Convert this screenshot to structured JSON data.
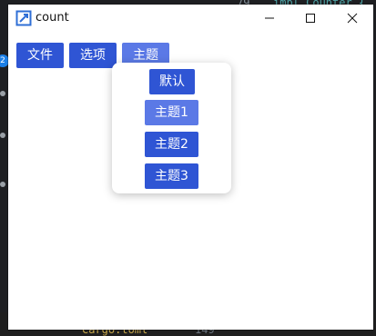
{
  "window": {
    "title": "count"
  },
  "menubar": {
    "items": [
      {
        "label": "文件"
      },
      {
        "label": "选项"
      },
      {
        "label": "主题"
      }
    ]
  },
  "theme_menu": {
    "items": [
      {
        "label": "默认"
      },
      {
        "label": "主题1"
      },
      {
        "label": "主题2"
      },
      {
        "label": "主题3"
      }
    ]
  },
  "background": {
    "badge": "2",
    "code_top": "impl Counter {",
    "line_num_top": "79",
    "file_label": "Cargo.toml",
    "line_num_bottom": "149"
  },
  "colors": {
    "button": "#2f55d4",
    "button_active": "#5b79e6"
  }
}
